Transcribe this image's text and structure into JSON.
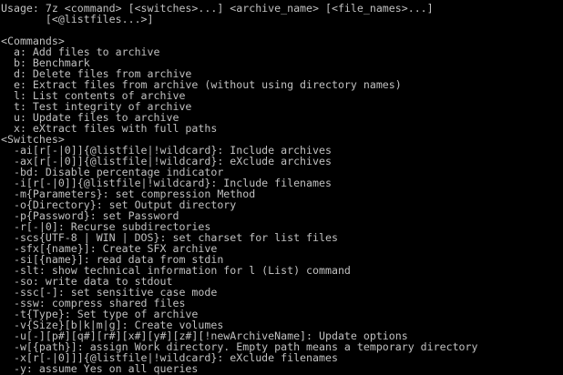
{
  "console": {
    "colors": {
      "background": "#000000",
      "text": "#c0c0c0"
    },
    "lines": [
      "Usage: 7z <command> [<switches>...] <archive_name> [<file_names>...]",
      "       [<@listfiles...>]",
      "",
      "<Commands>",
      "  a: Add files to archive",
      "  b: Benchmark",
      "  d: Delete files from archive",
      "  e: Extract files from archive (without using directory names)",
      "  l: List contents of archive",
      "  t: Test integrity of archive",
      "  u: Update files to archive",
      "  x: eXtract files with full paths",
      "<Switches>",
      "  -ai[r[-|0]]{@listfile|!wildcard}: Include archives",
      "  -ax[r[-|0]]{@listfile|!wildcard}: eXclude archives",
      "  -bd: Disable percentage indicator",
      "  -i[r[-|0]]{@listfile|!wildcard}: Include filenames",
      "  -m{Parameters}: set compression Method",
      "  -o{Directory}: set Output directory",
      "  -p{Password}: set Password",
      "  -r[-|0]: Recurse subdirectories",
      "  -scs{UTF-8 | WIN | DOS}: set charset for list files",
      "  -sfx[{name}]: Create SFX archive",
      "  -si[{name}]: read data from stdin",
      "  -slt: show technical information for l (List) command",
      "  -so: write data to stdout",
      "  -ssc[-]: set sensitive case mode",
      "  -ssw: compress shared files",
      "  -t{Type}: Set type of archive",
      "  -v{Size}[b|k|m|g]: Create volumes",
      "  -u[-][p#][q#][r#][x#][y#][z#][!newArchiveName]: Update options",
      "  -w[{path}]: assign Work directory. Empty path means a temporary directory",
      "  -x[r[-|0]]]{@listfile|!wildcard}: eXclude filenames",
      "  -y: assume Yes on all queries"
    ]
  }
}
